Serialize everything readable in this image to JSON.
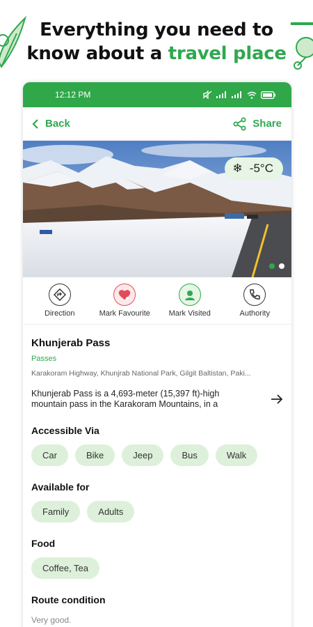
{
  "promo": {
    "line1": "Everything you need to",
    "line2_prefix": "know about a",
    "line2_accent": "travel place"
  },
  "status": {
    "time": "12:12 PM",
    "battery_icon": "battery-icon",
    "wifi_icon": "wifi-icon",
    "signal_icon": "signal-icon"
  },
  "topbar": {
    "back_label": "Back",
    "share_label": "Share"
  },
  "hero": {
    "temperature": "-5°C",
    "slides": 2,
    "active_slide": 1
  },
  "actions": [
    {
      "label": "Direction",
      "icon": "direction-icon"
    },
    {
      "label": "Mark Favourite",
      "icon": "heart-icon"
    },
    {
      "label": "Mark Visited",
      "icon": "visited-icon"
    },
    {
      "label": "Authority",
      "icon": "phone-icon"
    }
  ],
  "place": {
    "name": "Khunjerab Pass",
    "category": "Passes",
    "address": "Karakoram Highway, Khunjrab National Park, Gilgit Baltistan, Paki...",
    "description": "Khunjerab Pass is a 4,693-meter (15,397 ft)-high mountain pass in the Karakoram Mountains, in a"
  },
  "sections": {
    "accessible_title": "Accessible Via",
    "accessible": [
      "Car",
      "Bike",
      "Jeep",
      "Bus",
      "Walk"
    ],
    "available_title": "Available for",
    "available": [
      "Family",
      "Adults"
    ],
    "food_title": "Food",
    "food": [
      "Coffee, Tea"
    ],
    "route_title": "Route condition",
    "route_value": "Very good."
  },
  "colors": {
    "brand_green": "#30a84a",
    "chip_bg": "#ddf1da",
    "fav_red": "#e34b5a"
  }
}
